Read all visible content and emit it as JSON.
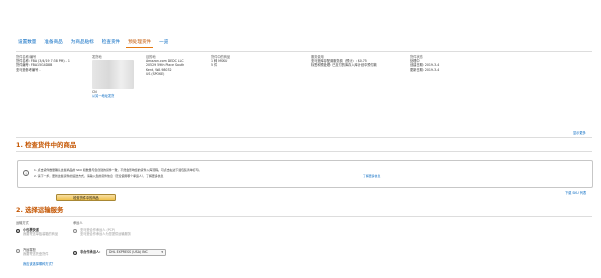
{
  "tabs": [
    {
      "label": "设置数量"
    },
    {
      "label": "准备商品"
    },
    {
      "label": "为商品贴标"
    },
    {
      "label": "检查货件"
    },
    {
      "label": "预处理货件"
    },
    {
      "label": "一览"
    }
  ],
  "summary": {
    "col1": {
      "header": "货件名称/编号",
      "line1": "货件名称: FBA (3/4/19 7:38 PM) - 1",
      "line2": "货件编号: FBA15G4D8B",
      "line3": "亚马逊参考编号 -"
    },
    "col2": {
      "header": "发货地",
      "line1": "CN",
      "link": "从另一地址发货"
    },
    "col3": {
      "header": "目的地",
      "line1": "Amazon.com DEDC LLC",
      "line2": "20529 59th Place South",
      "line3": "Kent, WA 98032",
      "line4": "US (SPOKE)"
    },
    "col4": {
      "header": "货件中的商品",
      "line1": "1 种 MSKU",
      "line2": "5 件"
    },
    "col5": {
      "header": "服务费用",
      "line1": "亚马逊库存配置服务费（预计）: $0.75",
      "line2": "标签和预处理: 已支付的库存入库计划中预付款"
    },
    "col6": {
      "header": "货件状态",
      "line1": "处理中",
      "line2": "创建日期: 2019-3-4",
      "line3": "更新日期: 2019-3-4"
    }
  },
  "show_more": "显示更多",
  "section1": {
    "title": "1. 检查货件中的商品",
    "info_line1": "1. 点击货件数量确认这些商品的 SKU 和数量与您创建的货件一致，不然会影响您的货件入库流程。可点击右边下载包装清单打印。",
    "info_line2": "2. 请下一步，更新这些货件的运送方式，请输入您的货件信息（无论使用哪个承运人），了解更多信息",
    "info_link": "了解更多信息",
    "download_link": "下载 SKU 列表",
    "confirm_button": "检查货件中的商品"
  },
  "section2": {
    "title": "2. 选择运输服务",
    "col_left_header": "运输方式",
    "col_right_header": "承运人",
    "option1_title": "小包裹快递",
    "option1_sub": "我要寄送单独装箱的商品",
    "carrier1_title": "亚马逊合作承运人 (PCP)",
    "carrier1_sub": "亚马逊合作承运人为您提供运输服务",
    "option2_title": "汽运零担",
    "option2_sub": "我要寄送托盘货件",
    "carrier2_label": "非合作承运人:",
    "carrier2_value": "DHL EXPRESS (USA) INC",
    "bottom_link": "我应该选择哪种方式？"
  },
  "colors": {
    "link": "#0066c0",
    "accent": "#c45500",
    "tab_underline": "#e47911"
  }
}
